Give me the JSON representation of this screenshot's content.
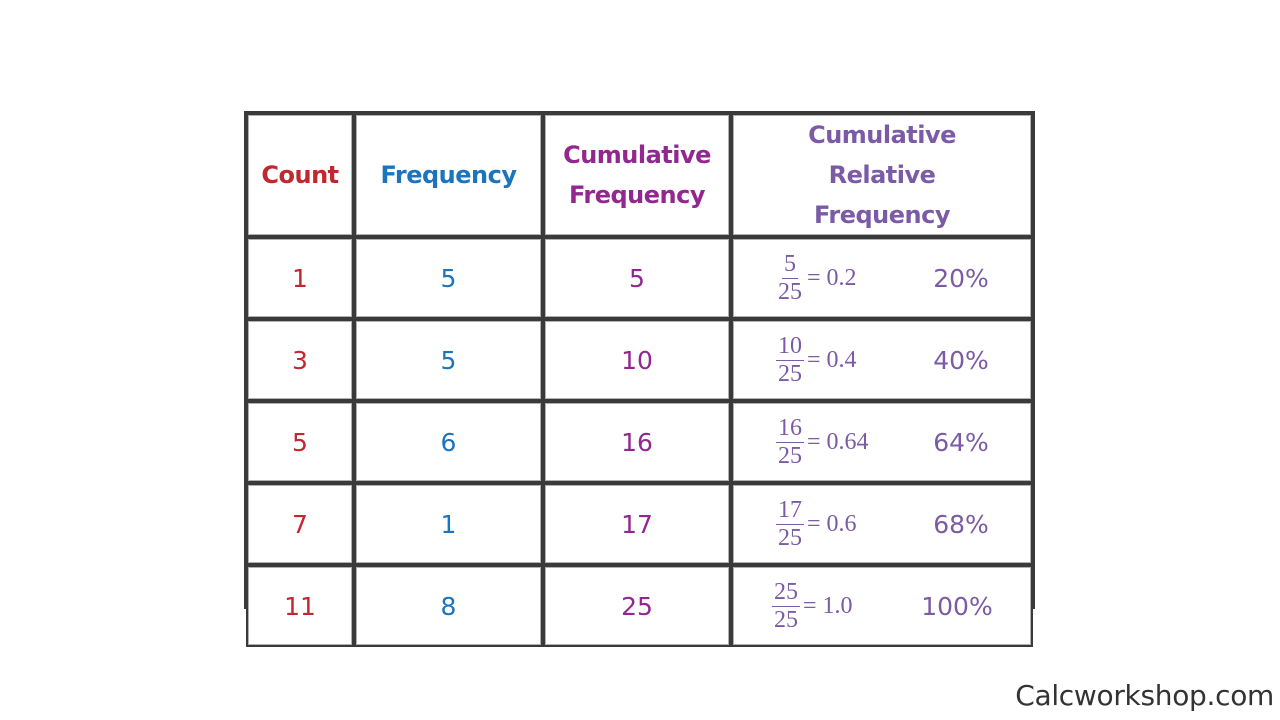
{
  "table": {
    "headers": {
      "count": "Count",
      "frequency": "Frequency",
      "cumulative_frequency": "Cumulative Frequency",
      "cumulative_relative_frequency": "Cumulative Relative Frequency"
    },
    "rows": [
      {
        "count": "1",
        "frequency": "5",
        "cumulative_frequency": "5",
        "numerator": "5",
        "denominator": "25",
        "equals": "= 0.2",
        "percent": "20%"
      },
      {
        "count": "3",
        "frequency": "5",
        "cumulative_frequency": "10",
        "numerator": "10",
        "denominator": "25",
        "equals": "= 0.4",
        "percent": "40%"
      },
      {
        "count": "5",
        "frequency": "6",
        "cumulative_frequency": "16",
        "numerator": "16",
        "denominator": "25",
        "equals": "= 0.64",
        "percent": "64%"
      },
      {
        "count": "7",
        "frequency": "1",
        "cumulative_frequency": "17",
        "numerator": "17",
        "denominator": "25",
        "equals": "= 0.6",
        "percent": "68%"
      },
      {
        "count": "11",
        "frequency": "8",
        "cumulative_frequency": "25",
        "numerator": "25",
        "denominator": "25",
        "equals": "= 1.0",
        "percent": "100%"
      }
    ]
  },
  "colors": {
    "count": "#C1272D",
    "frequency": "#1C75BC",
    "cumulative_frequency": "#92278F",
    "cumulative_relative_frequency": "#7B5AA6"
  },
  "watermark": "Calcworkshop.com"
}
